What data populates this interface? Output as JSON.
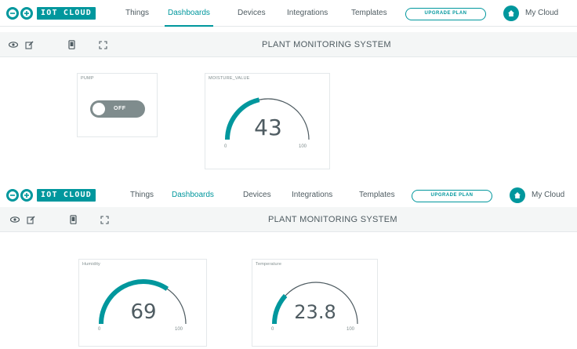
{
  "colors": {
    "accent": "#00979d",
    "text": "#4e5b61",
    "muted": "#7f8c8d",
    "border": "#e4e8ea",
    "toolbar_bg": "#f4f6f6",
    "gauge_track": "#4e5b61",
    "switch_off": "#7f8c8d"
  },
  "screens": [
    {
      "header": {
        "logo_text": "IOT CLOUD",
        "nav": [
          "Things",
          "Dashboards",
          "Devices",
          "Integrations",
          "Templates"
        ],
        "active_nav": "Dashboards",
        "upgrade_label": "UPGRADE PLAN",
        "account_label": "My Cloud"
      },
      "toolbar": {
        "title": "PLANT MONITORING SYSTEM",
        "icons": [
          "eye-icon",
          "edit-icon",
          "phone-icon",
          "fullscreen-icon"
        ]
      },
      "widgets": [
        {
          "type": "switch",
          "title": "PUMP",
          "state_label": "OFF"
        },
        {
          "type": "gauge",
          "title": "MOISTURE_VALUE",
          "value": "43",
          "min": "0",
          "max": "100",
          "fraction": 0.43
        }
      ]
    },
    {
      "header": {
        "logo_text": "IOT CLOUD",
        "nav": [
          "Things",
          "Dashboards",
          "Devices",
          "Integrations",
          "Templates"
        ],
        "active_nav": "Dashboards",
        "upgrade_label": "UPGRADE PLAN",
        "account_label": "My Cloud"
      },
      "toolbar": {
        "title": "PLANT MONITORING SYSTEM",
        "icons": [
          "eye-icon",
          "edit-icon",
          "phone-icon",
          "fullscreen-icon"
        ]
      },
      "widgets": [
        {
          "type": "gauge",
          "title": "Humidity",
          "value": "69",
          "min": "0",
          "max": "100",
          "fraction": 0.69
        },
        {
          "type": "gauge",
          "title": "Temperature",
          "value": "23.8",
          "min": "0",
          "max": "100",
          "fraction": 0.238
        }
      ]
    }
  ]
}
